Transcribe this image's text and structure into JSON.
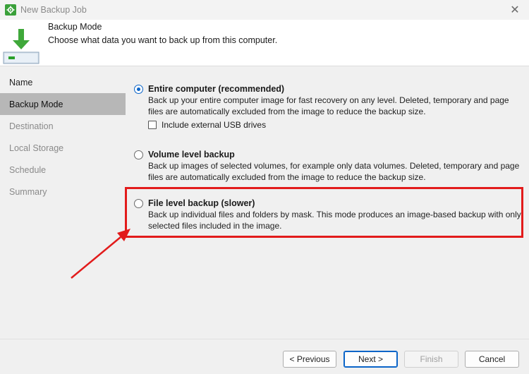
{
  "window": {
    "title": "New Backup Job",
    "app_icon": "gear-icon",
    "close_icon": "close-icon"
  },
  "header": {
    "title": "Backup Mode",
    "subtitle": "Choose what data you want to back up from this computer."
  },
  "sidebar": {
    "items": [
      {
        "label": "Name"
      },
      {
        "label": "Backup Mode"
      },
      {
        "label": "Destination"
      },
      {
        "label": "Local Storage"
      },
      {
        "label": "Schedule"
      },
      {
        "label": "Summary"
      }
    ],
    "active": "Backup Mode"
  },
  "options": [
    {
      "title": "Entire computer (recommended)",
      "description": "Back up your entire computer image for fast recovery on any level. Deleted, temporary and page files are automatically excluded from the image to reduce the backup size.",
      "selected": true
    },
    {
      "title": "Volume level backup",
      "description": "Back up images of selected volumes, for example only data volumes. Deleted, temporary and page files are automatically excluded from the image to reduce the backup size.",
      "selected": false
    },
    {
      "title": "File level backup (slower)",
      "description": "Back up individual files and folders by mask. This mode produces an image-based backup with only selected files included in the image.",
      "selected": false
    }
  ],
  "usb_checkbox": {
    "label": "Include external USB drives",
    "checked": false
  },
  "annotation": {
    "color": "#e21b1b"
  },
  "buttons": {
    "previous": "< Previous",
    "next": "Next >",
    "finish": "Finish",
    "cancel": "Cancel"
  },
  "colors": {
    "accent": "#0a64c8",
    "icon_green": "#3aa03a"
  }
}
